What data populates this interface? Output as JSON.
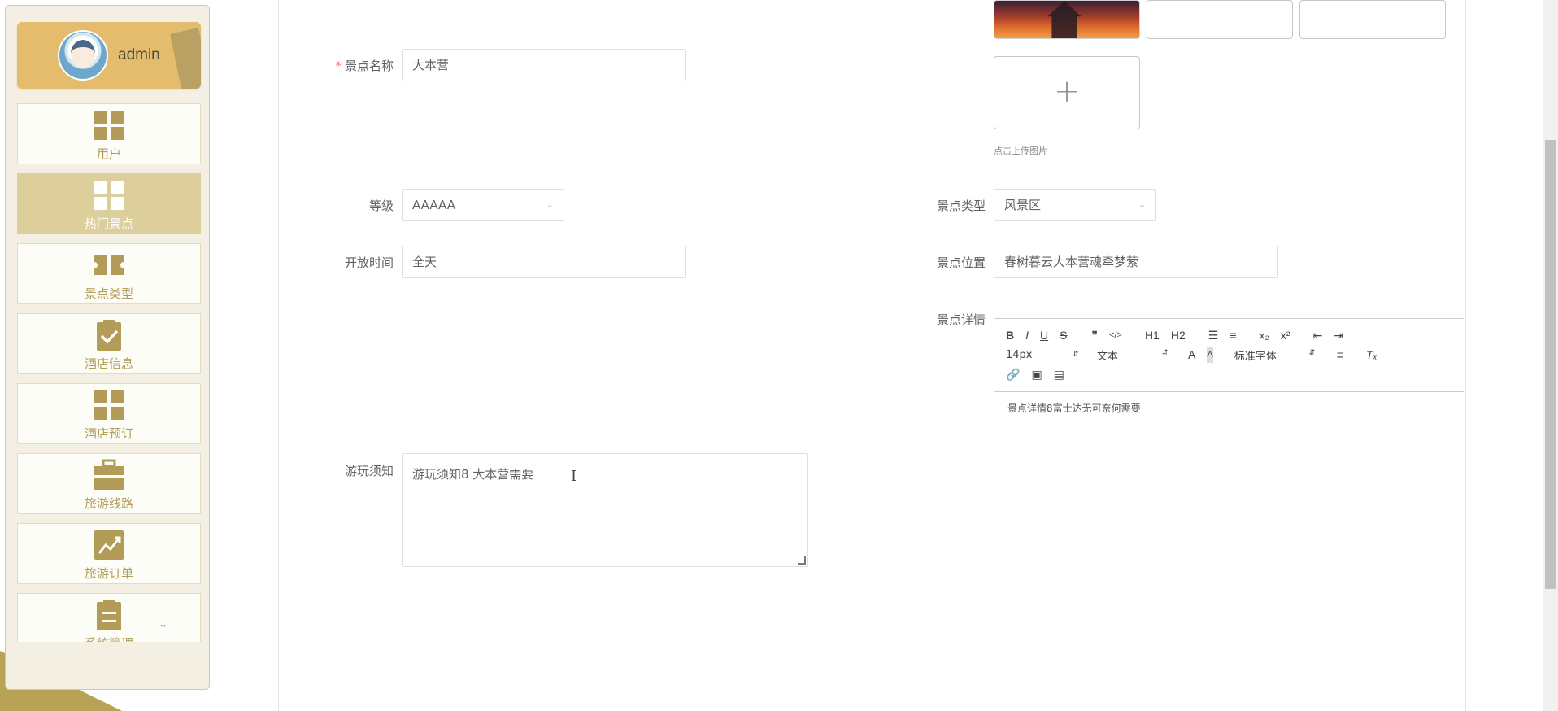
{
  "sidebar": {
    "user": {
      "name": "admin",
      "avatar_icon": "avatar-icon"
    },
    "items": [
      {
        "label": "用户",
        "icon": "grid-icon",
        "active": false
      },
      {
        "label": "热门景点",
        "icon": "grid-icon",
        "active": true
      },
      {
        "label": "景点类型",
        "icon": "ticket-icon",
        "active": false
      },
      {
        "label": "酒店信息",
        "icon": "clipboard-check-icon",
        "active": false
      },
      {
        "label": "酒店预订",
        "icon": "grid-icon",
        "active": false
      },
      {
        "label": "旅游线路",
        "icon": "briefcase-icon",
        "active": false
      },
      {
        "label": "旅游订单",
        "icon": "chart-line-icon",
        "active": false
      },
      {
        "label": "系统管理",
        "icon": "clipboard-list-icon",
        "active": false,
        "has_chevron": true
      }
    ]
  },
  "form": {
    "name": {
      "label": "景点名称",
      "value": "大本营",
      "required": true
    },
    "level": {
      "label": "等级",
      "value": "AAAAA"
    },
    "open_time": {
      "label": "开放时间",
      "value": "全天"
    },
    "notice": {
      "label": "游玩须知",
      "value": "游玩须知8   大本营需要"
    },
    "type": {
      "label": "景点类型",
      "value": "风景区"
    },
    "location": {
      "label": "景点位置",
      "value": "春树暮云大本营魂牵梦萦"
    },
    "upload": {
      "tip": "点击上传图片",
      "plus": "+"
    },
    "details": {
      "label": "景点详情",
      "content": "景点详情8富士达无可奈何需要",
      "toolbar": {
        "row1": [
          "B",
          "I",
          "U",
          "S",
          "❞",
          "</>",
          "H1",
          "H2",
          "ol",
          "ul",
          "x₂",
          "x²",
          "outdent",
          "indent"
        ],
        "font_size": "14px",
        "text_style": "文本",
        "font_family": "标准字体"
      }
    }
  }
}
